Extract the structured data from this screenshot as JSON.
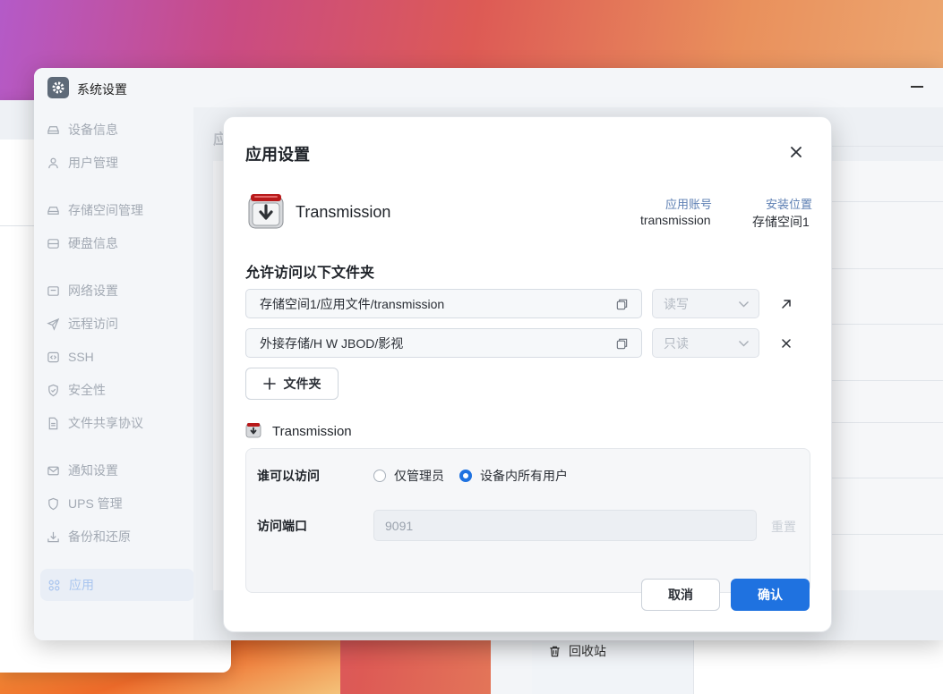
{
  "window": {
    "title": "系统设置"
  },
  "sidebar": {
    "items": [
      {
        "label": "设备信息",
        "icon": "device-icon"
      },
      {
        "label": "用户管理",
        "icon": "user-icon"
      },
      {
        "label": "存储空间管理",
        "icon": "storage-icon"
      },
      {
        "label": "硬盘信息",
        "icon": "disk-icon"
      },
      {
        "label": "网络设置",
        "icon": "network-icon"
      },
      {
        "label": "远程访问",
        "icon": "send-icon"
      },
      {
        "label": "SSH",
        "icon": "code-icon"
      },
      {
        "label": "安全性",
        "icon": "shield-check-icon"
      },
      {
        "label": "文件共享协议",
        "icon": "document-icon"
      },
      {
        "label": "通知设置",
        "icon": "mail-icon"
      },
      {
        "label": "UPS 管理",
        "icon": "shield-icon"
      },
      {
        "label": "备份和还原",
        "icon": "backup-icon"
      },
      {
        "label": "应用",
        "icon": "apps-icon"
      }
    ],
    "active_index": 12
  },
  "content": {
    "title": "应"
  },
  "modal": {
    "title": "应用设置",
    "app": {
      "name": "Transmission",
      "account_label": "应用账号",
      "account_value": "transmission",
      "location_label": "安装位置",
      "location_value": "存储空间1"
    },
    "folders_title": "允许访问以下文件夹",
    "folders": [
      {
        "path": "存储空间1/应用文件/transmission",
        "permission": "读写",
        "action": "open-external"
      },
      {
        "path": "外接存储/H W JBOD/影视",
        "permission": "只读",
        "action": "remove"
      }
    ],
    "add_folder_label": "文件夹",
    "sub_section": {
      "title": "Transmission",
      "access_label": "谁可以访问",
      "options": [
        {
          "label": "仅管理员",
          "selected": false
        },
        {
          "label": "设备内所有用户",
          "selected": true
        }
      ],
      "port_label": "访问端口",
      "port_value": "9091",
      "reset_label": "重置"
    },
    "cancel_label": "取消",
    "confirm_label": "确认"
  },
  "background": {
    "trash_label": "回收站"
  },
  "colors": {
    "accent": "#1f72e0",
    "muted_text": "#a3aab4"
  }
}
